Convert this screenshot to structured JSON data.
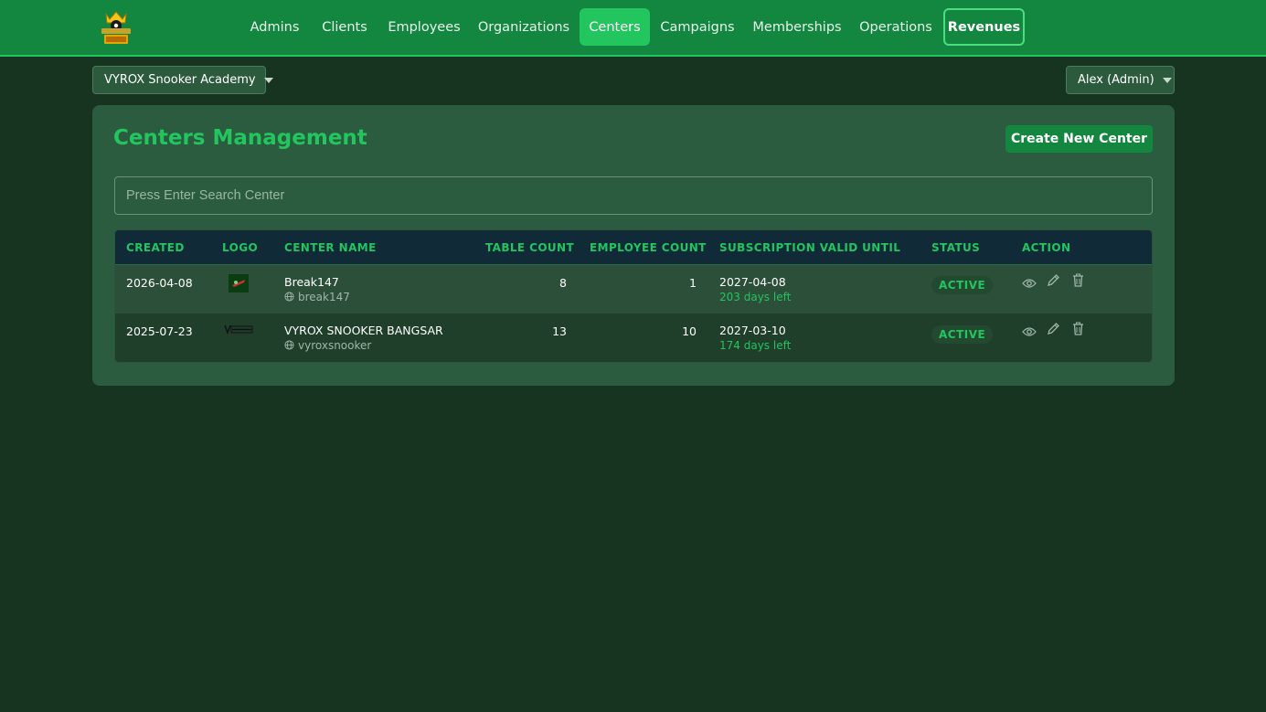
{
  "brand": {
    "logo_icon": "snooker-king-logo"
  },
  "nav": {
    "items": [
      {
        "label": "Admins"
      },
      {
        "label": "Clients"
      },
      {
        "label": "Employees"
      },
      {
        "label": "Organizations"
      },
      {
        "label": "Centers",
        "active": true
      },
      {
        "label": "Campaigns"
      },
      {
        "label": "Memberships"
      },
      {
        "label": "Operations"
      },
      {
        "label": "Revenues",
        "outlined": true
      }
    ]
  },
  "org_selector": {
    "value": "VYROX Snooker Academy"
  },
  "user_menu": {
    "value": "Alex (Admin)"
  },
  "page": {
    "title": "Centers Management",
    "create_label": "Create New Center",
    "search_placeholder": "Press Enter Search Center"
  },
  "table": {
    "headers": {
      "created": "CREATED",
      "logo": "LOGO",
      "center_name": "CENTER NAME",
      "table_count": "TABLE COUNT",
      "employee_count": "EMPLOYEE COUNT",
      "subscription": "SUBSCRIPTION VALID UNTIL",
      "status": "STATUS",
      "action": "ACTION"
    },
    "rows": [
      {
        "created": "2026-04-08",
        "name": "Break147",
        "slug": "break147",
        "table_count": "8",
        "employee_count": "1",
        "valid_until": "2027-04-08",
        "days_left": "203 days left",
        "status": "ACTIVE"
      },
      {
        "created": "2025-07-23",
        "name": "VYROX SNOOKER BANGSAR",
        "slug": "vyroxsnooker",
        "table_count": "13",
        "employee_count": "10",
        "valid_until": "2027-03-10",
        "days_left": "174 days left",
        "status": "ACTIVE"
      }
    ]
  },
  "colors": {
    "nav_bg": "#138640",
    "accent": "#22c55e",
    "page_bg": "#173421",
    "panel_bg": "#2b5c3f",
    "table_header_bg": "#102a38"
  }
}
